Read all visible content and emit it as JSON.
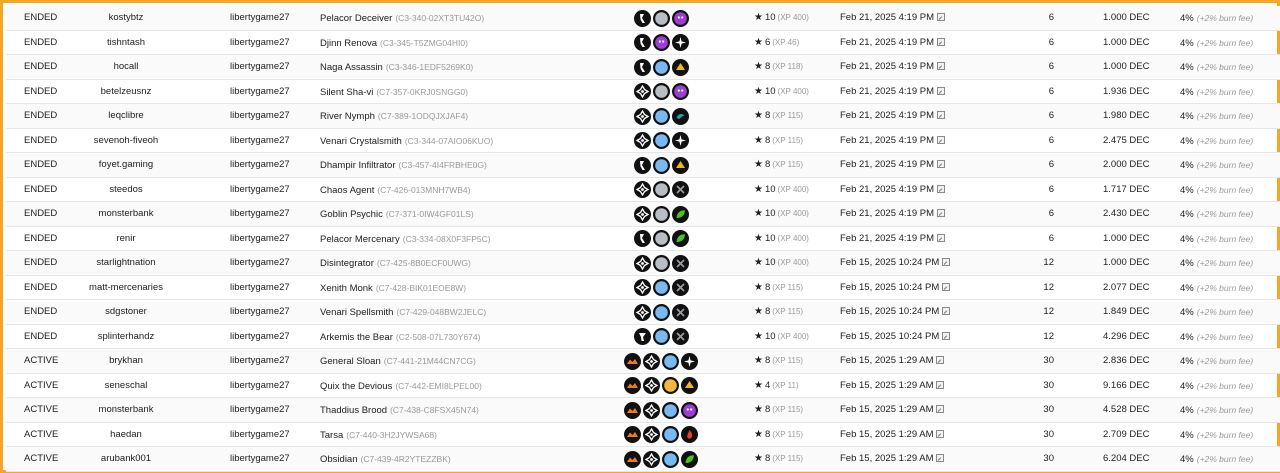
{
  "rows": [
    {
      "status": "ENDED",
      "renter": "kostybtz",
      "owner": "libertygame27",
      "card": "Pelacor Deceiver",
      "uid": "(C3-340-02XT3TU42O)",
      "icons": [
        "splinter-death",
        "neutral-gray",
        "element-purple"
      ],
      "level": "10",
      "xp": "(XP 400)",
      "date": "Feb 21, 2025 4:19 PM",
      "days": "6",
      "price": "1.000 DEC",
      "fee": "4%",
      "burn": "(+2% burn fee)"
    },
    {
      "status": "ENDED",
      "renter": "tishntash",
      "owner": "libertygame27",
      "card": "Djinn Renova",
      "uid": "(C3-345-T5ZMG04HI0)",
      "icons": [
        "splinter-death",
        "element-purple",
        "element-star"
      ],
      "level": "6",
      "xp": "(XP 46)",
      "date": "Feb 21, 2025 4:19 PM",
      "days": "6",
      "price": "1.000 DEC",
      "fee": "4%",
      "burn": "(+2% burn fee)"
    },
    {
      "status": "ENDED",
      "renter": "hocall",
      "owner": "libertygame27",
      "card": "Naga Assassin",
      "uid": "(C3-346-1EDF5269K0)",
      "icons": [
        "splinter-death",
        "element-blue",
        "element-yellow"
      ],
      "level": "8",
      "xp": "(XP 118)",
      "date": "Feb 21, 2025 4:19 PM",
      "days": "6",
      "price": "1.000 DEC",
      "fee": "4%",
      "burn": "(+2% burn fee)"
    },
    {
      "status": "ENDED",
      "renter": "betelzeusnz",
      "owner": "libertygame27",
      "card": "Silent Sha-vi",
      "uid": "(C7-357-0KRJ0SNGG0)",
      "icons": [
        "splinter-dragon",
        "neutral-gray",
        "element-purple"
      ],
      "level": "10",
      "xp": "(XP 400)",
      "date": "Feb 21, 2025 4:19 PM",
      "days": "6",
      "price": "1.936 DEC",
      "fee": "4%",
      "burn": "(+2% burn fee)"
    },
    {
      "status": "ENDED",
      "renter": "leqclibre",
      "owner": "libertygame27",
      "card": "River Nymph",
      "uid": "(C7-389-1ODQJXJAF4)",
      "icons": [
        "splinter-dragon",
        "element-blue",
        "element-teal"
      ],
      "level": "8",
      "xp": "(XP 115)",
      "date": "Feb 21, 2025 4:19 PM",
      "days": "6",
      "price": "1.980 DEC",
      "fee": "4%",
      "burn": "(+2% burn fee)"
    },
    {
      "status": "ENDED",
      "renter": "sevenoh-fiveoh",
      "owner": "libertygame27",
      "card": "Venari Crystalsmith",
      "uid": "(C3-344-07AIO06KUO)",
      "icons": [
        "splinter-dragon",
        "element-blue",
        "element-star"
      ],
      "level": "8",
      "xp": "(XP 115)",
      "date": "Feb 21, 2025 4:19 PM",
      "days": "6",
      "price": "2.475 DEC",
      "fee": "4%",
      "burn": "(+2% burn fee)"
    },
    {
      "status": "ENDED",
      "renter": "foyet.gaming",
      "owner": "libertygame27",
      "card": "Dhampir Infiltrator",
      "uid": "(C3-457-4I4FRBHE0G)",
      "icons": [
        "splinter-death",
        "element-blue",
        "element-yellow"
      ],
      "level": "8",
      "xp": "(XP 115)",
      "date": "Feb 21, 2025 4:19 PM",
      "days": "6",
      "price": "2.000 DEC",
      "fee": "4%",
      "burn": "(+2% burn fee)"
    },
    {
      "status": "ENDED",
      "renter": "steedos",
      "owner": "libertygame27",
      "card": "Chaos Agent",
      "uid": "(C7-426-013MNH7WB4)",
      "icons": [
        "splinter-dragon",
        "neutral-gray",
        "element-sword"
      ],
      "level": "10",
      "xp": "(XP 400)",
      "date": "Feb 21, 2025 4:19 PM",
      "days": "6",
      "price": "1.717 DEC",
      "fee": "4%",
      "burn": "(+2% burn fee)"
    },
    {
      "status": "ENDED",
      "renter": "monsterbank",
      "owner": "libertygame27",
      "card": "Goblin Psychic",
      "uid": "(C7-371-0IW4GF01LS)",
      "icons": [
        "splinter-dragon",
        "neutral-gray",
        "element-green"
      ],
      "level": "10",
      "xp": "(XP 400)",
      "date": "Feb 21, 2025 4:19 PM",
      "days": "6",
      "price": "2.430 DEC",
      "fee": "4%",
      "burn": "(+2% burn fee)"
    },
    {
      "status": "ENDED",
      "renter": "renir",
      "owner": "libertygame27",
      "card": "Pelacor Mercenary",
      "uid": "(C3-334-08X0F3FP5C)",
      "icons": [
        "splinter-death",
        "neutral-gray",
        "element-green"
      ],
      "level": "10",
      "xp": "(XP 400)",
      "date": "Feb 21, 2025 4:19 PM",
      "days": "6",
      "price": "1.000 DEC",
      "fee": "4%",
      "burn": "(+2% burn fee)"
    },
    {
      "status": "ENDED",
      "renter": "starlightnation",
      "owner": "libertygame27",
      "card": "Disintegrator",
      "uid": "(C7-425-8B0ECF0UWG)",
      "icons": [
        "splinter-dragon",
        "neutral-gray",
        "element-sword"
      ],
      "level": "10",
      "xp": "(XP 400)",
      "date": "Feb 15, 2025 10:24 PM",
      "days": "12",
      "price": "1.000 DEC",
      "fee": "4%",
      "burn": "(+2% burn fee)"
    },
    {
      "status": "ENDED",
      "renter": "matt-mercenaries",
      "owner": "libertygame27",
      "card": "Xenith Monk",
      "uid": "(C7-428-BIK01EOE8W)",
      "icons": [
        "splinter-dragon",
        "element-blue",
        "element-sword"
      ],
      "level": "8",
      "xp": "(XP 115)",
      "date": "Feb 15, 2025 10:24 PM",
      "days": "12",
      "price": "2.077 DEC",
      "fee": "4%",
      "burn": "(+2% burn fee)"
    },
    {
      "status": "ENDED",
      "renter": "sdgstoner",
      "owner": "libertygame27",
      "card": "Venari Spellsmith",
      "uid": "(C7-429-048BW2JELC)",
      "icons": [
        "splinter-dragon",
        "element-blue",
        "element-sword"
      ],
      "level": "8",
      "xp": "(XP 115)",
      "date": "Feb 15, 2025 10:24 PM",
      "days": "12",
      "price": "1.849 DEC",
      "fee": "4%",
      "burn": "(+2% burn fee)"
    },
    {
      "status": "ENDED",
      "renter": "splinterhandz",
      "owner": "libertygame27",
      "card": "Arkemis the Bear",
      "uid": "(C2-508-07L730Y674)",
      "icons": [
        "splinter-earth",
        "element-blue",
        "element-sword"
      ],
      "level": "10",
      "xp": "(XP 400)",
      "date": "Feb 15, 2025 10:24 PM",
      "days": "12",
      "price": "4.296 DEC",
      "fee": "4%",
      "burn": "(+2% burn fee)"
    },
    {
      "status": "ACTIVE",
      "renter": "brykhan",
      "owner": "libertygame27",
      "card": "General Sloan",
      "uid": "(C7-441-21M44CN7CG)",
      "icons": [
        "splinter-fire",
        "splinter-dragon",
        "element-blue",
        "element-star"
      ],
      "level": "8",
      "xp": "(XP 115)",
      "date": "Feb 15, 2025 1:29 AM",
      "days": "30",
      "price": "2.836 DEC",
      "fee": "4%",
      "burn": "(+2% burn fee)"
    },
    {
      "status": "ACTIVE",
      "renter": "seneschal",
      "owner": "libertygame27",
      "card": "Quix the Devious",
      "uid": "(C7-442-EMI8LPEL00)",
      "icons": [
        "splinter-fire",
        "splinter-dragon",
        "element-gold",
        "element-yellow"
      ],
      "level": "4",
      "xp": "(XP 11)",
      "date": "Feb 15, 2025 1:29 AM",
      "days": "30",
      "price": "9.166 DEC",
      "fee": "4%",
      "burn": "(+2% burn fee)"
    },
    {
      "status": "ACTIVE",
      "renter": "monsterbank",
      "owner": "libertygame27",
      "card": "Thaddius Brood",
      "uid": "(C7-438-C8FSX45N74)",
      "icons": [
        "splinter-fire",
        "splinter-dragon",
        "element-blue",
        "element-purple"
      ],
      "level": "8",
      "xp": "(XP 115)",
      "date": "Feb 15, 2025 1:29 AM",
      "days": "30",
      "price": "4.528 DEC",
      "fee": "4%",
      "burn": "(+2% burn fee)"
    },
    {
      "status": "ACTIVE",
      "renter": "haedan",
      "owner": "libertygame27",
      "card": "Tarsa",
      "uid": "(C7-440-3H2JYWSA68)",
      "icons": [
        "splinter-fire",
        "splinter-dragon",
        "element-blue",
        "element-red"
      ],
      "level": "8",
      "xp": "(XP 115)",
      "date": "Feb 15, 2025 1:29 AM",
      "days": "30",
      "price": "2.709 DEC",
      "fee": "4%",
      "burn": "(+2% burn fee)"
    },
    {
      "status": "ACTIVE",
      "renter": "arubank001",
      "owner": "libertygame27",
      "card": "Obsidian",
      "uid": "(C7-439-4R2YTEZZBK)",
      "icons": [
        "splinter-fire",
        "splinter-dragon",
        "element-blue",
        "element-green"
      ],
      "level": "8",
      "xp": "(XP 115)",
      "date": "Feb 15, 2025 1:29 AM",
      "days": "30",
      "price": "6.204 DEC",
      "fee": "4%",
      "burn": "(+2% burn fee)"
    }
  ],
  "icon_colors": {
    "splinter-death": "#111111",
    "splinter-dragon": "#111111",
    "splinter-earth": "#111111",
    "splinter-fire": "#111111",
    "neutral-gray": "#b9bec4",
    "element-blue": "#7ab8f0",
    "element-purple": "#9b3fd1",
    "element-star": "#111111",
    "element-yellow": "#f2b51e",
    "element-teal": "#1ca3b5",
    "element-sword": "#111111",
    "element-green": "#4cc51a",
    "element-gold": "#f2b73c",
    "element-red": "#e5442a"
  }
}
